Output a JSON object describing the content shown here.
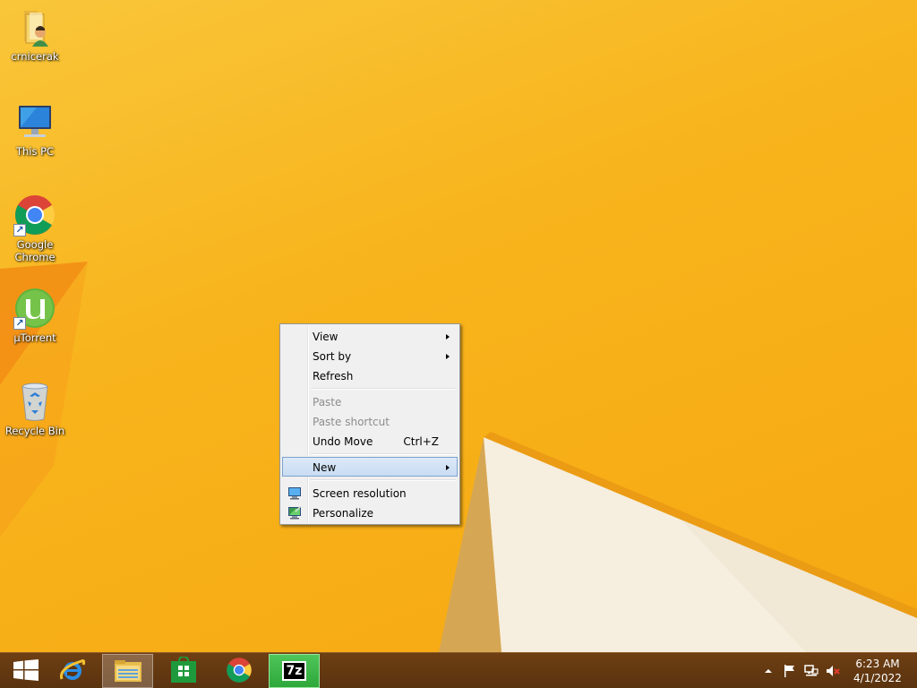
{
  "desktop": {
    "icons": [
      {
        "label": "crnicerak",
        "icon": "user-folder-icon"
      },
      {
        "label": "This PC",
        "icon": "computer-icon"
      },
      {
        "label": "Google Chrome",
        "icon": "chrome-icon",
        "shortcut": true
      },
      {
        "label": "µTorrent",
        "icon": "utorrent-icon",
        "shortcut": true
      },
      {
        "label": "Recycle Bin",
        "icon": "recycle-bin-icon"
      }
    ]
  },
  "context_menu": {
    "items": [
      {
        "label": "View",
        "submenu": true,
        "enabled": true
      },
      {
        "label": "Sort by",
        "submenu": true,
        "enabled": true
      },
      {
        "label": "Refresh",
        "enabled": true
      },
      {
        "label": "Paste",
        "enabled": false
      },
      {
        "label": "Paste shortcut",
        "enabled": false
      },
      {
        "label": "Undo Move",
        "shortcut": "Ctrl+Z",
        "enabled": true
      },
      {
        "label": "New",
        "submenu": true,
        "enabled": true,
        "highlighted": true
      },
      {
        "label": "Screen resolution",
        "icon": "screen-resolution-icon",
        "enabled": true
      },
      {
        "label": "Personalize",
        "icon": "personalize-icon",
        "enabled": true
      }
    ]
  },
  "taskbar": {
    "buttons": [
      {
        "name": "start",
        "icon": "windows-logo-icon"
      },
      {
        "name": "internet-explorer",
        "icon": "internet-explorer-icon"
      },
      {
        "name": "file-explorer",
        "icon": "file-explorer-icon",
        "state": "active"
      },
      {
        "name": "store",
        "icon": "store-icon"
      },
      {
        "name": "chrome",
        "icon": "chrome-icon"
      },
      {
        "name": "7-zip",
        "icon": "7zip-icon",
        "label": "7z",
        "state": "selected"
      }
    ],
    "tray": {
      "icons": [
        "show-hidden-icons-arrow",
        "action-center-flag-icon",
        "network-icon",
        "volume-muted-icon"
      ],
      "time": "6:23 AM",
      "date": "4/1/2022"
    }
  },
  "colors": {
    "wallpaper": "#f8b51a",
    "taskbar": "#5f3610",
    "menu_bg": "#f0f0f0",
    "menu_highlight": "#cfe0f4",
    "selected_app": "#3cb648"
  }
}
